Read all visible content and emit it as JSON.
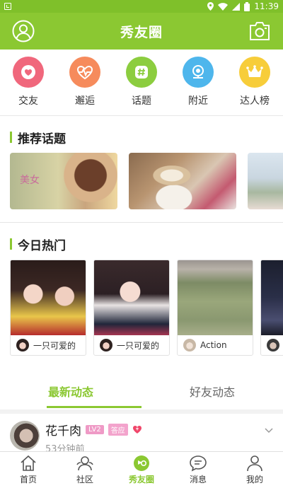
{
  "status_bar": {
    "time": "11:39"
  },
  "header": {
    "title": "秀友圈"
  },
  "quick_nav": [
    {
      "label": "交友",
      "icon": "heart-icon",
      "color": "#f0677c"
    },
    {
      "label": "邂逅",
      "icon": "heartbeat-icon",
      "color": "#f68b5c"
    },
    {
      "label": "话题",
      "icon": "hashtag-icon",
      "color": "#8ccd3f"
    },
    {
      "label": "附近",
      "icon": "location-icon",
      "color": "#4eb6ec"
    },
    {
      "label": "达人榜",
      "icon": "crown-icon",
      "color": "#f7cd3a"
    }
  ],
  "recommended": {
    "title": "推荐话题",
    "cards": [
      {
        "tag": "美女"
      },
      {
        "tag": ""
      },
      {
        "tag": ""
      }
    ]
  },
  "hot_today": {
    "title": "今日热门",
    "cards": [
      {
        "user": "一只可爱的"
      },
      {
        "user": "一只可爱的"
      },
      {
        "user": "Action"
      },
      {
        "user": ""
      }
    ]
  },
  "tabs": [
    {
      "label": "最新动态",
      "active": true
    },
    {
      "label": "好友动态",
      "active": false
    }
  ],
  "feed": [
    {
      "name": "花千肉",
      "level": "LV2",
      "badge": "答应",
      "time": "53分钟前"
    }
  ],
  "bottom_nav": [
    {
      "label": "首页",
      "icon": "home-icon"
    },
    {
      "label": "社区",
      "icon": "community-icon"
    },
    {
      "label": "秀友圈",
      "icon": "circle-icon",
      "active": true
    },
    {
      "label": "消息",
      "icon": "message-icon"
    },
    {
      "label": "我的",
      "icon": "profile-icon"
    }
  ],
  "colors": {
    "brand": "#8bc832",
    "status_bar": "#7fc02a"
  }
}
